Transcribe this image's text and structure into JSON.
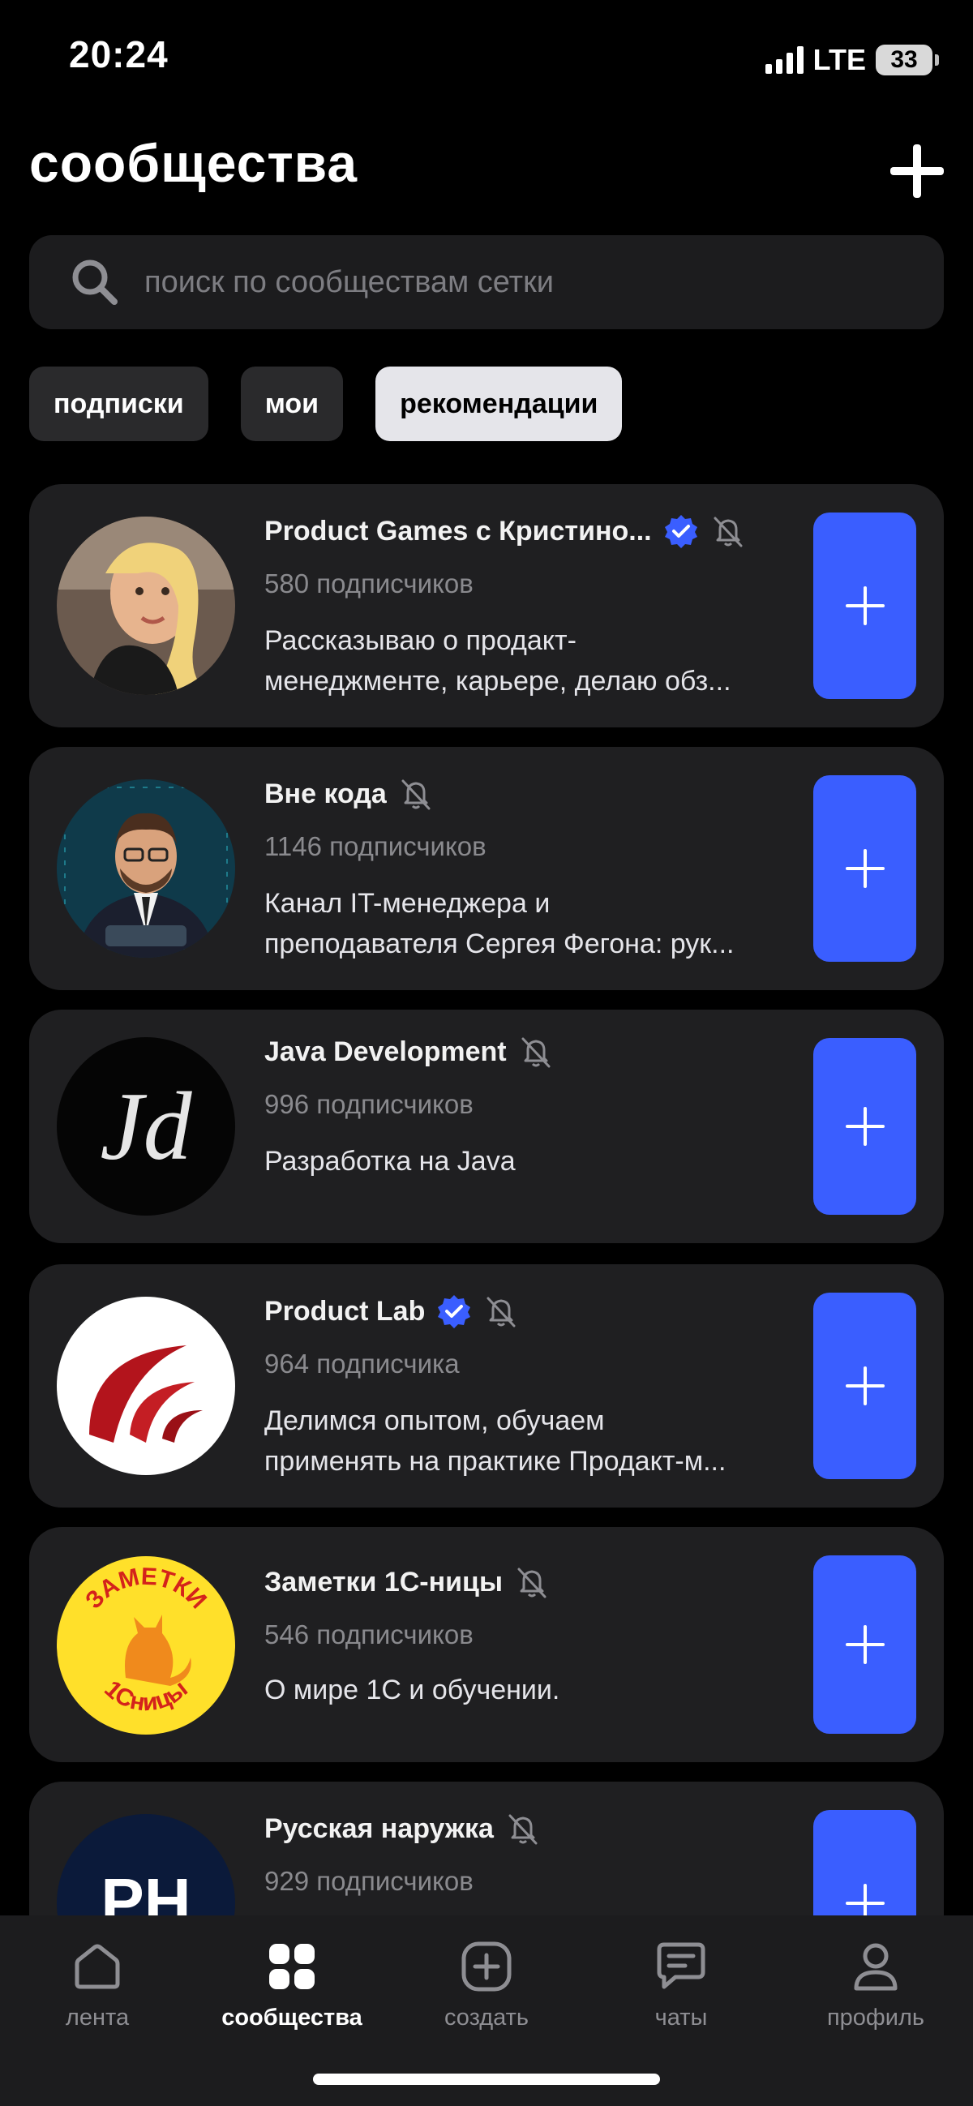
{
  "status_bar": {
    "time": "20:24",
    "network": "LTE",
    "battery": "33"
  },
  "header": {
    "title": "сообщества",
    "add_icon": "plus-icon"
  },
  "search": {
    "placeholder": "поиск по сообществам сетки",
    "icon": "search-icon"
  },
  "filters": [
    {
      "label": "подписки",
      "active": false
    },
    {
      "label": "мои",
      "active": false
    },
    {
      "label": "рекомендации",
      "active": true
    }
  ],
  "communities": [
    {
      "name": "Product Games с Кристино...",
      "verified": true,
      "muted": true,
      "subscribers": "580 подписчиков",
      "description": [
        "Рассказываю о продакт-",
        "менеджменте, карьере, делаю обз..."
      ]
    },
    {
      "name": "Вне кода",
      "verified": false,
      "muted": true,
      "subscribers": "1146 подписчиков",
      "description": [
        "Канал IT-менеджера и",
        "преподавателя Сергея Фегона: рук..."
      ]
    },
    {
      "name": "Java Development",
      "verified": false,
      "muted": true,
      "subscribers": "996 подписчиков",
      "description": [
        "Разработка на Java"
      ],
      "avatar_text": "Jd"
    },
    {
      "name": "Product Lab",
      "verified": true,
      "muted": true,
      "subscribers": "964 подписчика",
      "description": [
        "Делимся опытом, обучаем",
        "применять на практике Продакт-м..."
      ]
    },
    {
      "name": "Заметки 1С-ницы",
      "verified": false,
      "muted": true,
      "subscribers": "546 подписчиков",
      "description": [
        "О мире 1С и обучении."
      ],
      "avatar_text": [
        "ЗАМЕТКИ",
        "1Сницы"
      ]
    },
    {
      "name": "Русская наружка",
      "verified": false,
      "muted": true,
      "subscribers": "929 подписчиков",
      "description": [],
      "avatar_text": "PH"
    }
  ],
  "tab_bar": [
    {
      "label": "лента",
      "icon": "home-icon",
      "active": false
    },
    {
      "label": "сообщества",
      "icon": "grid-icon",
      "active": true
    },
    {
      "label": "создать",
      "icon": "plus-square-icon",
      "active": false
    },
    {
      "label": "чаты",
      "icon": "chat-icon",
      "active": false
    },
    {
      "label": "профиль",
      "icon": "profile-icon",
      "active": false
    }
  ],
  "colors": {
    "accent": "#3a5eff",
    "background": "#000000",
    "card": "#1f1f21",
    "verified": "#3a5eff"
  }
}
